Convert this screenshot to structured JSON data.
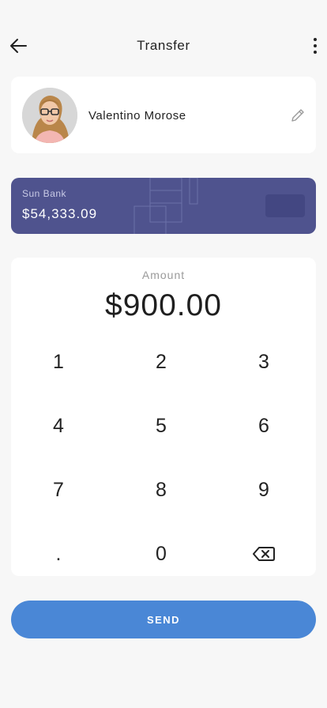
{
  "header": {
    "title": "Transfer",
    "back_icon": "arrow-left-icon",
    "more_icon": "more-vertical-icon"
  },
  "recipient": {
    "name": "Valentino Morose",
    "edit_icon": "pencil-icon"
  },
  "bank_card": {
    "bank_name": "Sun Bank",
    "balance": "$54,333.09",
    "color": "#4f538e"
  },
  "amount": {
    "label": "Amount",
    "value": "$900.00"
  },
  "keypad": {
    "keys": [
      "1",
      "2",
      "3",
      "4",
      "5",
      "6",
      "7",
      "8",
      "9",
      ".",
      "0"
    ],
    "backspace_icon": "backspace-icon"
  },
  "send_button": {
    "label": "SEND",
    "color": "#4a87d6"
  }
}
